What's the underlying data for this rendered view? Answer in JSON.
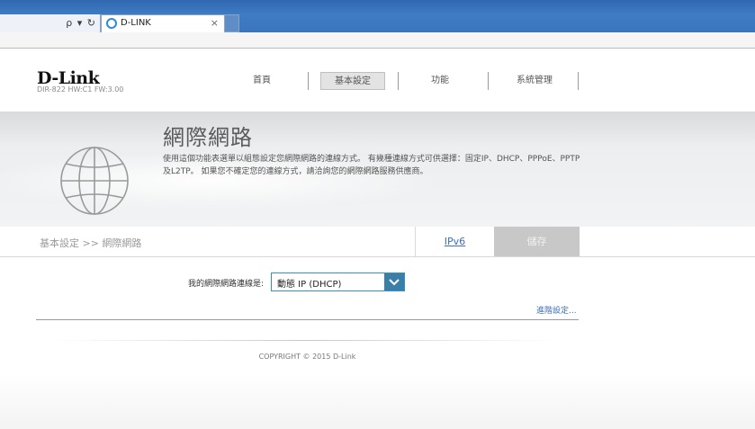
{
  "browser": {
    "address_controls": "ρ ▾ ↻",
    "tab_title": "D-LINK",
    "tab_close": "×"
  },
  "header": {
    "logo": "D-Link",
    "model": "DIR-822 HW:C1 FW:3.00",
    "nav": [
      {
        "label": "首頁"
      },
      {
        "label": "基本設定",
        "active": true
      },
      {
        "label": "功能"
      },
      {
        "label": "系統管理"
      }
    ]
  },
  "banner": {
    "title": "網際網路",
    "description": "使用這個功能表選單以組態設定您網際網路的連線方式。 有幾種連線方式可供選擇：固定IP、DHCP、PPPoE、PPTP及L2TP。 如果您不確定您的連線方式，請洽詢您的網際網路服務供應商。"
  },
  "breadcrumb": "基本設定 >> 網際網路",
  "buttons": {
    "ipv6": "IPv6",
    "save": "儲存"
  },
  "form": {
    "connection_label": "我的網際網路連線是:",
    "connection_value": "動態 IP (DHCP)"
  },
  "advanced_link": "進階設定...",
  "footer": {
    "copyright": "COPYRIGHT © 2015 D-Link"
  },
  "colors": {
    "accent": "#3a7fa8",
    "link": "#3b6fb6",
    "save_button_bg": "#c8c8c8"
  }
}
